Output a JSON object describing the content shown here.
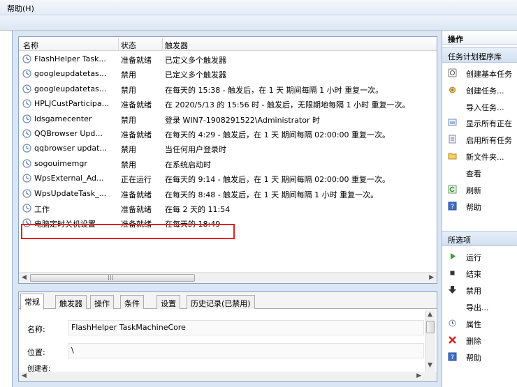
{
  "menubar": {
    "help": "帮助(H)"
  },
  "tasklist": {
    "columns": {
      "name": "名称",
      "status": "状态",
      "trigger": "触发器"
    },
    "rows": [
      {
        "name": "FlashHelper Task...",
        "status": "准备就绪",
        "trigger": "已定义多个触发器"
      },
      {
        "name": "googleupdatetas...",
        "status": "禁用",
        "trigger": "已定义多个触发器"
      },
      {
        "name": "googleupdatetas...",
        "status": "禁用",
        "trigger": "在每天的 15:38 - 触发后，在 1 天 期间每隔 1 小时 重复一次。"
      },
      {
        "name": "HPLJCustParticipa...",
        "status": "准备就绪",
        "trigger": "在 2020/5/13 的 15:56 时 - 触发后，无限期地每隔 1 小时 重复一次。"
      },
      {
        "name": "ldsgamecenter",
        "status": "禁用",
        "trigger": "登录 WIN7-1908291522\\Administrator 时"
      },
      {
        "name": "QQBrowser Upd...",
        "status": "准备就绪",
        "trigger": "在每天的 4:29 - 触发后，在 1 天 期间每隔 02:00:00 重复一次。"
      },
      {
        "name": "qqbrowser updat...",
        "status": "禁用",
        "trigger": "当任何用户登录时"
      },
      {
        "name": "sogouimemgr",
        "status": "禁用",
        "trigger": "在系统启动时"
      },
      {
        "name": "WpsExternal_Ad...",
        "status": "正在运行",
        "trigger": "在每天的 9:14 - 触发后，在 1 天 期间每隔 02:00:00 重复一次。"
      },
      {
        "name": "WpsUpdateTask_...",
        "status": "准备就绪",
        "trigger": "在每天的 8:48 - 触发后，在 1 天 期间每隔 1 小时 重复一次。"
      },
      {
        "name": "工作",
        "status": "准备就绪",
        "trigger": "在每 2 天的 11:54"
      },
      {
        "name": "电脑定时关机设置",
        "status": "准备就绪",
        "trigger": "在每天的 18:49"
      }
    ]
  },
  "detail": {
    "tabs": [
      "常规",
      "触发器",
      "操作",
      "条件",
      "设置",
      "历史记录(已禁用)"
    ],
    "name_label": "名称:",
    "name_value": "FlashHelper TaskMachineCore",
    "location_label": "位置:",
    "location_value": "\\",
    "author_label": "创建者:"
  },
  "actions": {
    "title": "操作",
    "section1": "任务计划程序库",
    "items1": [
      "创建基本任务",
      "创建任务...",
      "导入任务...",
      "显示所有正在",
      "启用所有任务",
      "新文件夹...",
      "查看",
      "刷新",
      "帮助"
    ],
    "section2": "所选项",
    "items2": [
      "运行",
      "结束",
      "禁用",
      "导出...",
      "属性",
      "删除",
      "帮助"
    ]
  },
  "colors": {
    "highlight": "#e3211f",
    "section_bg": "#d2e0f1"
  }
}
